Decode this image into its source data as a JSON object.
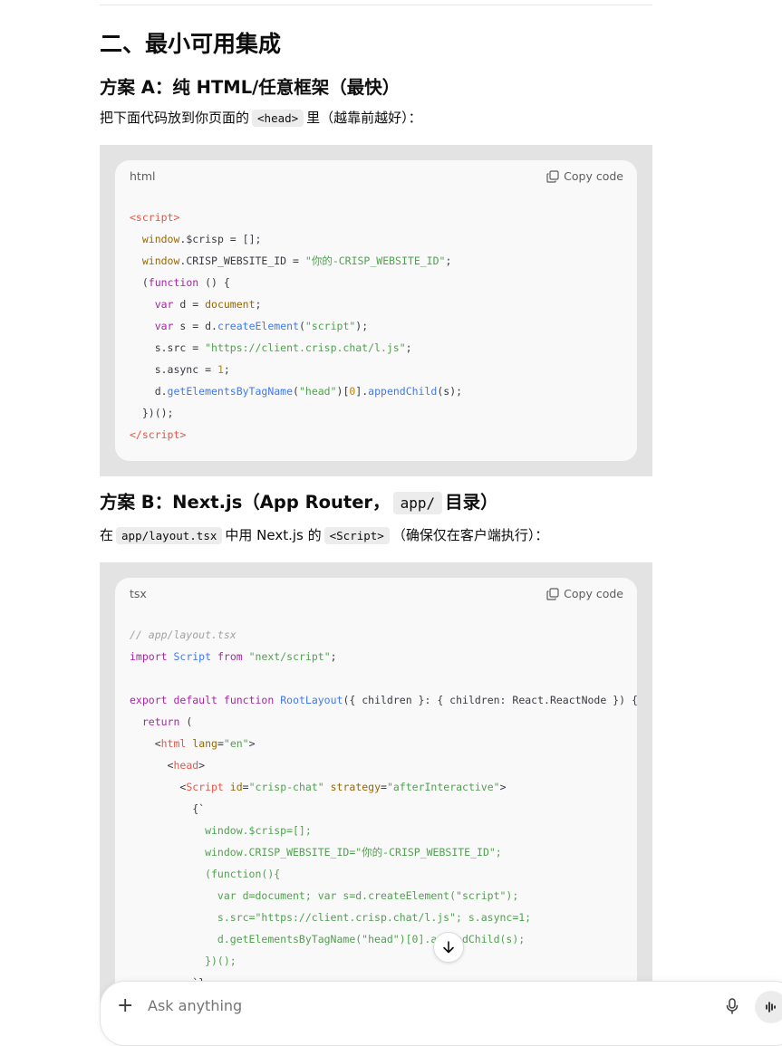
{
  "section_heading": "二、最小可用集成",
  "plan_a": {
    "title": "方案 A：纯 HTML/任意框架（最快）",
    "desc_before": "把下面代码放到你页面的",
    "desc_code": "<head>",
    "desc_after": "里（越靠前越好）："
  },
  "code_block_1": {
    "language": "html",
    "copy_label": "Copy code"
  },
  "plan_b": {
    "title_before": "方案 B：Next.js（App Router，",
    "title_code": "app/",
    "title_after": "目录）",
    "desc_1": "在",
    "desc_code_1": "app/layout.tsx",
    "desc_2": "中用 Next.js 的",
    "desc_code_2": "<Script>",
    "desc_3": "（确保仅在客户端执行）："
  },
  "code_block_2": {
    "language": "tsx",
    "copy_label": "Copy code"
  },
  "composer": {
    "placeholder": "Ask anything"
  }
}
